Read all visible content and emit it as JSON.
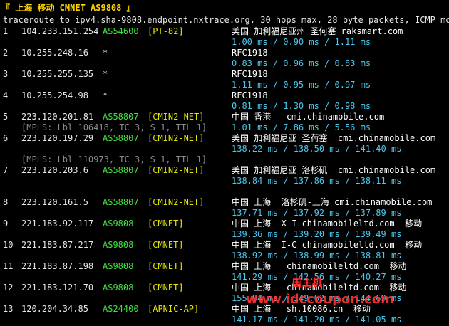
{
  "header": {
    "title": "『 上海 移动 CMNET AS9808 』",
    "traceroute": "traceroute to ipv4.sha-9808.endpoint.nxtrace.org, 30 hops max, 28 byte packets, ICMP mode"
  },
  "hops": [
    {
      "num": "1",
      "ip": "104.233.151.254",
      "asn": "AS54600",
      "tag": "[PT-82]",
      "geo": "美国 加利福尼亚州 圣何塞 raksmart.com",
      "lat": "1.00 ms / 0.90 ms / 1.11 ms"
    },
    {
      "num": "2",
      "ip": "10.255.248.16",
      "asn": "*",
      "tag": "",
      "geo": "RFC1918",
      "lat": "0.83 ms / 0.96 ms / 0.83 ms"
    },
    {
      "num": "3",
      "ip": "10.255.255.135",
      "asn": "*",
      "tag": "",
      "geo": "RFC1918",
      "lat": "1.11 ms / 0.95 ms / 0.97 ms"
    },
    {
      "num": "4",
      "ip": "10.255.254.98",
      "asn": "*",
      "tag": "",
      "geo": "RFC1918",
      "lat": "0.81 ms / 1.30 ms / 0.98 ms"
    },
    {
      "num": "5",
      "ip": "223.120.201.81",
      "asn": "AS58807",
      "tag": "[CMIN2-NET]",
      "geo": "中国 香港   cmi.chinamobile.com",
      "lat": "1.01 ms / 7.86 ms / 5.56 ms"
    },
    {
      "num": "6",
      "ip": "223.120.197.29",
      "asn": "AS58807",
      "tag": "[CMIN2-NET]",
      "geo": "美国 加利福尼亚 圣荷塞  cmi.chinamobile.com",
      "lat": "138.22 ms / 138.50 ms / 141.40 ms",
      "mpls": "[MPLS: Lbl 106418, TC 3, S 1, TTL 1]"
    },
    {
      "num": "7",
      "ip": "223.120.203.6",
      "asn": "AS58807",
      "tag": "[CMIN2-NET]",
      "geo": "美国 加利福尼亚 洛杉矶  cmi.chinamobile.com",
      "lat": "138.84 ms / 137.86 ms / 138.11 ms",
      "mpls": "[MPLS: Lbl 110973, TC 3, S 1, TTL 1]"
    },
    {
      "num": "8",
      "ip": "223.120.161.5",
      "asn": "AS58807",
      "tag": "[CMIN2-NET]",
      "geo": "中国 上海  洛杉矶-上海 cmi.chinamobile.com",
      "lat": "137.71 ms / 137.92 ms / 137.89 ms"
    },
    {
      "num": "9",
      "ip": "221.183.92.117",
      "asn": "AS9808",
      "tag": "[CMNET]",
      "geo": "中国 上海  X-I chinamobileltd.com  移动",
      "lat": "139.36 ms / 139.20 ms / 139.49 ms"
    },
    {
      "num": "10",
      "ip": "221.183.87.217",
      "asn": "AS9808",
      "tag": "[CMNET]",
      "geo": "中国 上海  I-C chinamobileltd.com  移动",
      "lat": "138.92 ms / 138.99 ms / 138.81 ms"
    },
    {
      "num": "11",
      "ip": "221.183.87.198",
      "asn": "AS9808",
      "tag": "[CMNET]",
      "geo": "中国 上海   chinamobileltd.com  移动",
      "lat": "141.29 ms / 142.56 ms / 140.27 ms"
    },
    {
      "num": "12",
      "ip": "221.183.121.70",
      "asn": "AS9808",
      "tag": "[CMNET]",
      "geo": "中国 上海   chinamobileltd.com  移动",
      "lat": "155.94 ms / 149.62 ms / 144.69 ms"
    },
    {
      "num": "13",
      "ip": "120.204.34.85",
      "asn": "AS24400",
      "tag": "[APNIC-AP]",
      "geo": "中国 上海   sh.10086.cn  移动",
      "lat": "141.17 ms / 141.20 ms / 141.05 ms"
    }
  ],
  "watermark": {
    "line1": "国主机",
    "line2": "www.idccoupon.com"
  }
}
